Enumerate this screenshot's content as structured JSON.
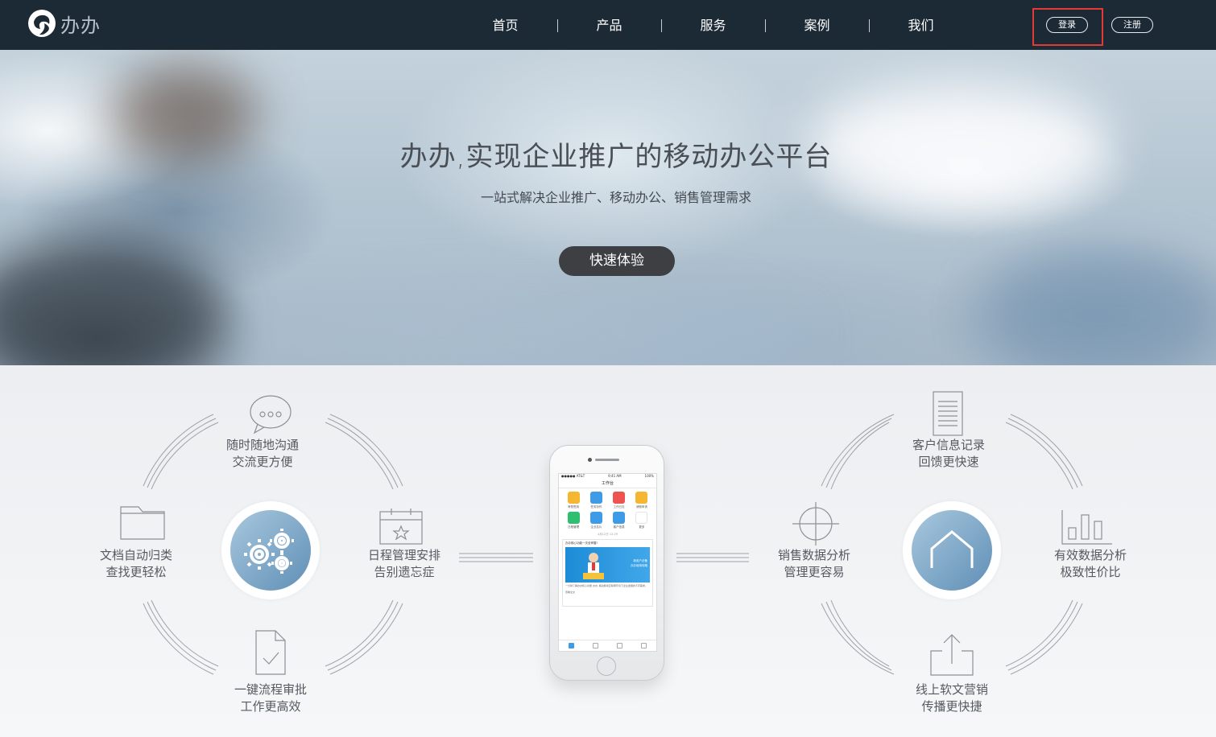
{
  "header": {
    "logo_text": "办办",
    "nav": [
      "首页",
      "产品",
      "服务",
      "案例",
      "我们"
    ],
    "login_label": "登录",
    "register_label": "注册"
  },
  "hero": {
    "title": "办办,实现企业推广的移动办公平台",
    "subtitle": "一站式解决企业推广、移动办公、销售管理需求",
    "cta_label": "快速体验"
  },
  "features_left": {
    "chat": [
      "随时随地沟通",
      "交流更方便"
    ],
    "files": [
      "文档自动归类",
      "查找更轻松"
    ],
    "schedule": [
      "日程管理安排",
      "告别遗忘症"
    ],
    "approval": [
      "一键流程审批",
      "工作更高效"
    ]
  },
  "features_right": {
    "customer": [
      "客户信息记录",
      "回馈更快速"
    ],
    "sales": [
      "销售数据分析",
      "管理更容易"
    ],
    "analytics": [
      "有效数据分析",
      "极致性价比"
    ],
    "marketing": [
      "线上软文营销",
      "传播更快捷"
    ]
  },
  "phone": {
    "status_carrier": "●●●●● AT&T",
    "status_time": "9:41 AM",
    "status_battery": "100%",
    "screen_title": "工作台",
    "apps": [
      {
        "label": "考勤签到",
        "color": "#f5b731"
      },
      {
        "label": "任务协作",
        "color": "#3e9be8"
      },
      {
        "label": "工作日志",
        "color": "#ef5350"
      },
      {
        "label": "请假申请",
        "color": "#f5b731"
      },
      {
        "label": "日程管理",
        "color": "#2fbf71"
      },
      {
        "label": "企业名片",
        "color": "#3e9be8"
      },
      {
        "label": "客户信息",
        "color": "#3e9be8"
      },
      {
        "label": "更多",
        "color": "#e3e3e3"
      }
    ],
    "date": "4月12日 12:29",
    "card_title": "办办核心功能一次全掌握!",
    "banner_line1": "新用户必备",
    "banner_line2": "办办使用攻略",
    "card_body": "一分钟了解办办核心功能 办办, 解决移动互联网环境下企业发展的不同需求。",
    "card_more": "查看全文"
  }
}
